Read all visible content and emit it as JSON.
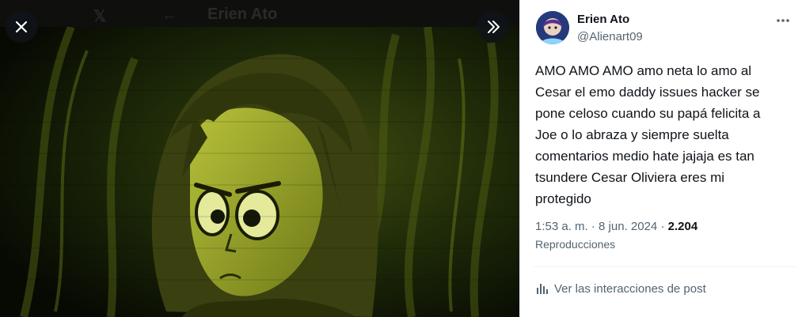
{
  "background_header": {
    "title": "Erien Ato"
  },
  "media": {
    "close_icon": "close-icon",
    "expand_icon": "double-chevron-right-icon"
  },
  "tweet": {
    "author": {
      "name": "Erien Ato",
      "handle": "@Alienart09"
    },
    "more_icon": "more-horizontal-icon",
    "text": "AMO AMO AMO amo neta lo amo al\nCesar el emo daddy issues hacker se\npone celoso cuando su papá felicita a\nJoe o lo abraza y siempre suelta\ncomentarios medio hate jajaja es tan\ntsundere Cesar Oliviera eres mi\nprotegido",
    "time": "1:53 a. m.",
    "date": "8 jun. 2024",
    "separator": "·",
    "views_count": "2.204",
    "views_label": "Reproducciones",
    "interactions_label": "Ver las interacciones de post",
    "interactions_icon": "analytics-bars-icon"
  },
  "colors": {
    "text_primary": "#0f1419",
    "text_secondary": "#536471",
    "media_tint": "#c8d23a"
  }
}
